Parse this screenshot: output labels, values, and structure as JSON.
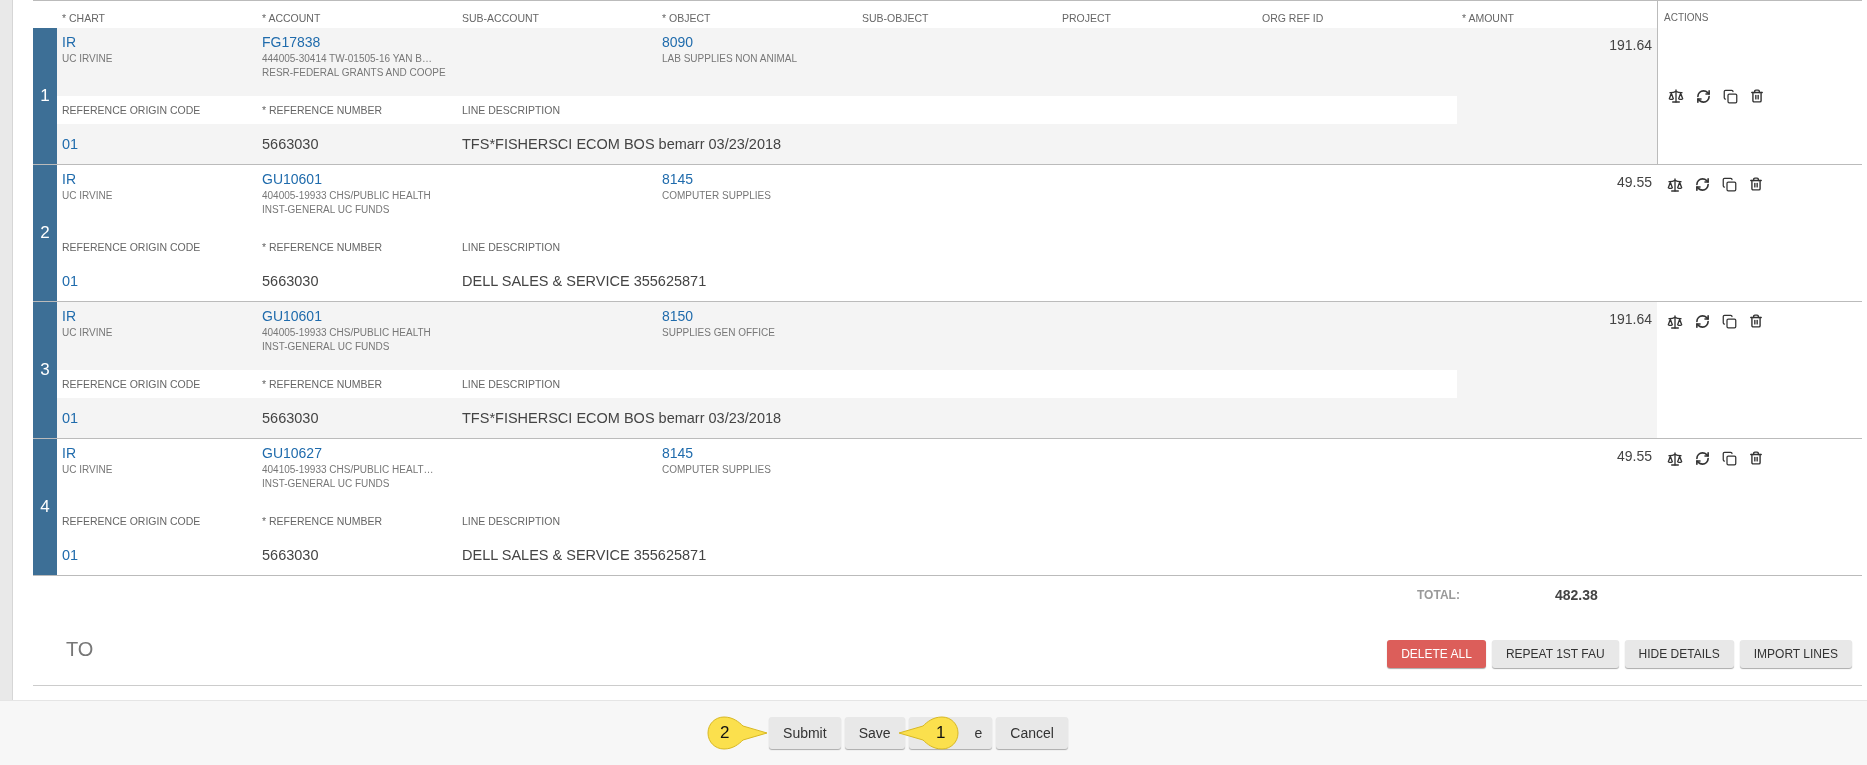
{
  "table": {
    "columns": [
      "* CHART",
      "* ACCOUNT",
      "SUB-ACCOUNT",
      "* OBJECT",
      "SUB-OBJECT",
      "PROJECT",
      "ORG REF ID",
      "* AMOUNT"
    ],
    "actions_heading": "ACTIONS",
    "rows": [
      {
        "number": "1",
        "chart": {
          "code": "IR",
          "name": "UC IRVINE"
        },
        "account": {
          "code": "FG17838",
          "lines": [
            "444005-30414 TW-01505-16 YAN B…",
            "RESR-FEDERAL GRANTS AND COOPE"
          ]
        },
        "object": {
          "code": "8090",
          "name": "LAB SUPPLIES NON ANIMAL"
        },
        "amount": "191.64",
        "reference_labels": [
          "REFERENCE ORIGIN CODE",
          "* REFERENCE NUMBER",
          "LINE DESCRIPTION"
        ],
        "reference_origin_code": "01",
        "reference_number": "5663030",
        "line_description": "TFS*FISHERSCI ECOM BOS bemarr 03/23/2018"
      },
      {
        "number": "2",
        "chart": {
          "code": "IR",
          "name": "UC IRVINE"
        },
        "account": {
          "code": "GU10601",
          "lines": [
            "404005-19933 CHS/PUBLIC HEALTH",
            "INST-GENERAL UC FUNDS"
          ]
        },
        "object": {
          "code": "8145",
          "name": "COMPUTER SUPPLIES"
        },
        "amount": "49.55",
        "reference_labels": [
          "REFERENCE ORIGIN CODE",
          "* REFERENCE NUMBER",
          "LINE DESCRIPTION"
        ],
        "reference_origin_code": "01",
        "reference_number": "5663030",
        "line_description": "DELL SALES & SERVICE 355625871"
      },
      {
        "number": "3",
        "chart": {
          "code": "IR",
          "name": "UC IRVINE"
        },
        "account": {
          "code": "GU10601",
          "lines": [
            "404005-19933 CHS/PUBLIC HEALTH",
            "INST-GENERAL UC FUNDS"
          ]
        },
        "object": {
          "code": "8150",
          "name": "SUPPLIES GEN OFFICE"
        },
        "amount": "191.64",
        "reference_labels": [
          "REFERENCE ORIGIN CODE",
          "* REFERENCE NUMBER",
          "LINE DESCRIPTION"
        ],
        "reference_origin_code": "01",
        "reference_number": "5663030",
        "line_description": "TFS*FISHERSCI ECOM BOS bemarr 03/23/2018"
      },
      {
        "number": "4",
        "chart": {
          "code": "IR",
          "name": "UC IRVINE"
        },
        "account": {
          "code": "GU10627",
          "lines": [
            "404105-19933 CHS/PUBLIC HEALT…",
            "INST-GENERAL UC FUNDS"
          ]
        },
        "object": {
          "code": "8145",
          "name": "COMPUTER SUPPLIES"
        },
        "amount": "49.55",
        "reference_labels": [
          "REFERENCE ORIGIN CODE",
          "* REFERENCE NUMBER",
          "LINE DESCRIPTION"
        ],
        "reference_origin_code": "01",
        "reference_number": "5663030",
        "line_description": "DELL SALES & SERVICE 355625871"
      }
    ]
  },
  "total": {
    "label": "TOTAL:",
    "value": "482.38"
  },
  "section_title": "TO",
  "section_buttons": [
    {
      "label": "DELETE ALL",
      "kind": "danger"
    },
    {
      "label": "REPEAT 1ST FAU",
      "kind": "default"
    },
    {
      "label": "HIDE DETAILS",
      "kind": "default"
    },
    {
      "label": "IMPORT LINES",
      "kind": "default"
    }
  ],
  "footer_buttons": [
    "Submit",
    "Save",
    "e",
    "Cancel"
  ],
  "callouts": [
    {
      "number": "2"
    },
    {
      "number": "1"
    }
  ]
}
